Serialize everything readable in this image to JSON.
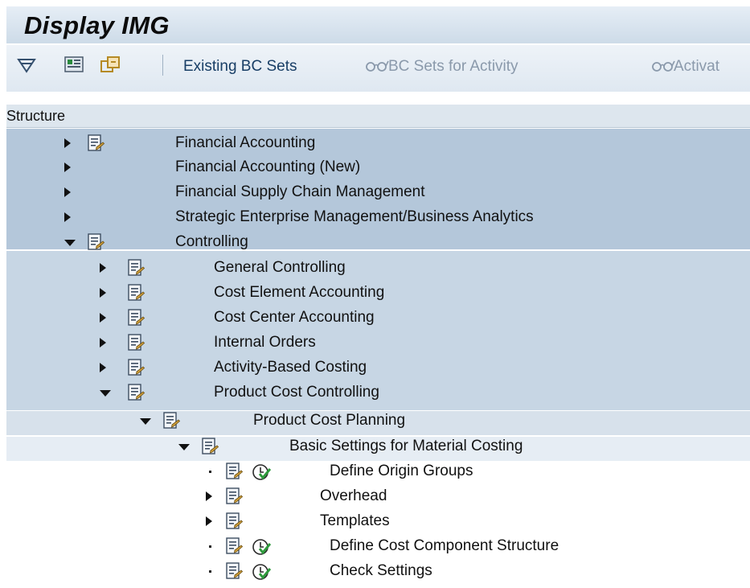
{
  "title": "Display IMG",
  "toolbar": {
    "existing_bc_sets": "Existing BC Sets",
    "bc_sets_for_activity": "BC Sets for Activity",
    "activat": "Activat"
  },
  "structure": {
    "header": "Structure",
    "rows": [
      {
        "label": "Financial Accounting",
        "level": 0,
        "toggle": "right",
        "doc": true,
        "clock": false
      },
      {
        "label": "Financial Accounting (New)",
        "level": 0,
        "toggle": "right",
        "doc": false,
        "clock": false
      },
      {
        "label": "Financial Supply Chain Management",
        "level": 0,
        "toggle": "right",
        "doc": false,
        "clock": false
      },
      {
        "label": "Strategic Enterprise Management/Business Analytics",
        "level": 0,
        "toggle": "right",
        "doc": false,
        "clock": false
      },
      {
        "label": "Controlling",
        "level": 0,
        "toggle": "down",
        "doc": true,
        "clock": false
      },
      {
        "label": "General Controlling",
        "level": 1,
        "toggle": "right",
        "doc": true,
        "clock": false
      },
      {
        "label": "Cost Element Accounting",
        "level": 1,
        "toggle": "right",
        "doc": true,
        "clock": false
      },
      {
        "label": "Cost Center Accounting",
        "level": 1,
        "toggle": "right",
        "doc": true,
        "clock": false
      },
      {
        "label": "Internal Orders",
        "level": 1,
        "toggle": "right",
        "doc": true,
        "clock": false
      },
      {
        "label": "Activity-Based Costing",
        "level": 1,
        "toggle": "right",
        "doc": true,
        "clock": false
      },
      {
        "label": "Product Cost Controlling",
        "level": 1,
        "toggle": "down",
        "doc": true,
        "clock": false
      },
      {
        "label": "Product Cost Planning",
        "level": 2,
        "toggle": "down",
        "doc": true,
        "clock": false
      },
      {
        "label": "Basic Settings for Material Costing",
        "level": 3,
        "toggle": "down",
        "doc": true,
        "clock": false
      },
      {
        "label": "Define Origin Groups",
        "level": 4,
        "toggle": "dot",
        "doc": true,
        "clock": true
      },
      {
        "label": "Overhead",
        "level": 4,
        "toggle": "right",
        "doc": true,
        "clock": false
      },
      {
        "label": "Templates",
        "level": 4,
        "toggle": "right",
        "doc": true,
        "clock": false
      },
      {
        "label": "Define Cost Component Structure",
        "level": 4,
        "toggle": "dot",
        "doc": true,
        "clock": true
      },
      {
        "label": "Check Settings",
        "level": 4,
        "toggle": "dot",
        "doc": true,
        "clock": true
      }
    ]
  }
}
